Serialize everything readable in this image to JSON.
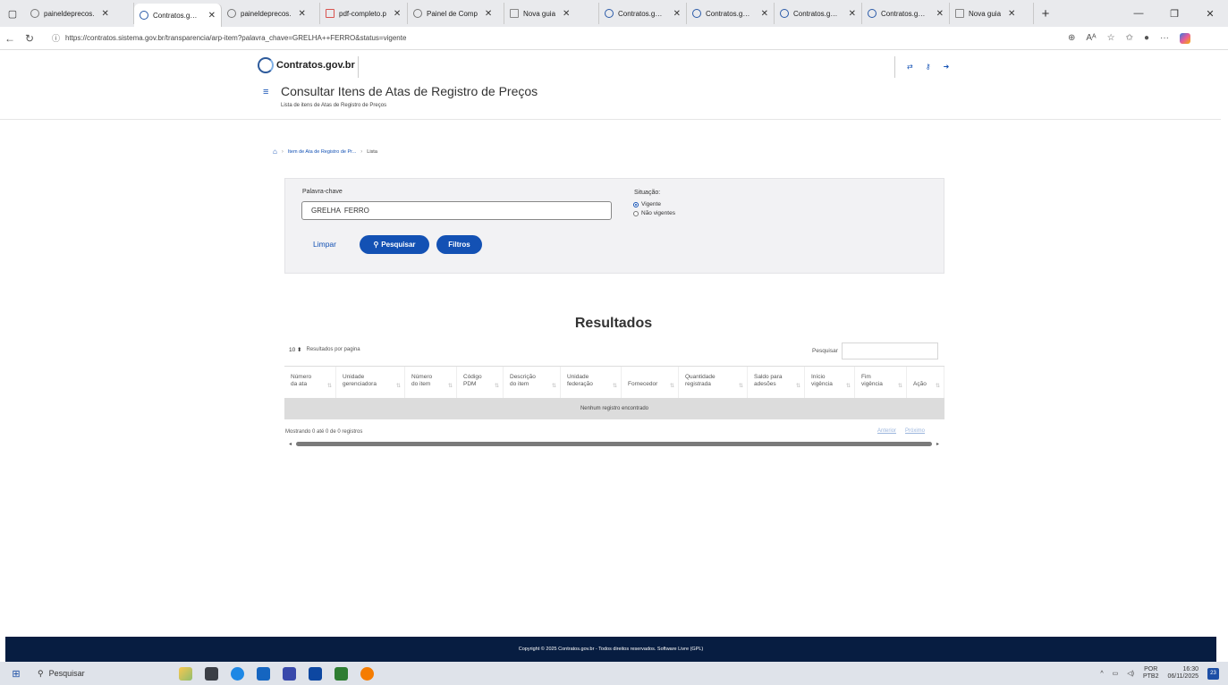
{
  "browser": {
    "tabs": [
      {
        "label": "paineldeprecos.",
        "icon": "globe-icon",
        "active": false
      },
      {
        "label": "Contratos.gov.br",
        "icon": "contratos-icon",
        "active": true
      },
      {
        "label": "paineldeprecos.",
        "icon": "globe-icon",
        "active": false
      },
      {
        "label": "pdf-completo.p",
        "icon": "pdf-icon",
        "active": false
      },
      {
        "label": "Painel de Comp",
        "icon": "globe-icon",
        "active": false
      },
      {
        "label": "Nova guia",
        "icon": "page-icon",
        "active": false
      },
      {
        "label": "Contratos.gov.br",
        "icon": "contratos-icon",
        "active": false
      },
      {
        "label": "Contratos.gov.br",
        "icon": "contratos-icon",
        "active": false
      },
      {
        "label": "Contratos.gov.br",
        "icon": "contratos-icon",
        "active": false
      },
      {
        "label": "Contratos.gov.br",
        "icon": "contratos-icon",
        "active": false
      },
      {
        "label": "Nova guia",
        "icon": "page-icon",
        "active": false
      }
    ],
    "url": "https://contratos.sistema.gov.br/transparencia/arp-item?palavra_chave=GRELHA++FERRO&status=vigente"
  },
  "site": {
    "logo_text": "Contratos.gov.br",
    "page_title": "Consultar Itens de Atas de Registro de Preços",
    "page_subtitle": "Lista de itens de Atas de Registro de Preços"
  },
  "breadcrumb": {
    "item1": "Item de Ata de Registro de Pr...",
    "item2": "Lista"
  },
  "search": {
    "keyword_label": "Palavra-chave",
    "keyword_value": "GRELHA  FERRO",
    "situation_label": "Situação:",
    "option_active": "Vigente",
    "option_inactive": "Não vigentes",
    "clear_label": "Limpar",
    "search_label": "Pesquisar",
    "filters_label": "Filtros"
  },
  "results": {
    "title": "Resultados",
    "per_page_value": "10",
    "per_page_label": "Resultados por pagina",
    "search_label": "Pesquisar",
    "columns": [
      [
        "Número",
        "da ata"
      ],
      [
        "Unidade",
        "gerenciadora"
      ],
      [
        "Número",
        "do item"
      ],
      [
        "Código",
        "PDM"
      ],
      [
        "Descrição",
        "do item"
      ],
      [
        "Unidade",
        "federação"
      ],
      [
        "",
        "Fornecedor"
      ],
      [
        "Quantidade",
        "registrada"
      ],
      [
        "Saldo para",
        "adesões"
      ],
      [
        "Início",
        "vigência"
      ],
      [
        "Fim",
        "vigência"
      ],
      [
        "",
        "Ação"
      ]
    ],
    "empty_message": "Nenhum registro encontrado",
    "showing": "Mostrando 0 até 0 de 0 registros",
    "prev": "Anterior",
    "next": "Próximo"
  },
  "footer": {
    "text": "Copyright © 2025 Contratos.gov.br - Todos direitos reservados. Software Livre (GPL)"
  },
  "taskbar": {
    "search_placeholder": "Pesquisar",
    "lang_top": "POR",
    "lang_bottom": "PTB2",
    "time": "16:30",
    "date": "06/11/2025",
    "notifications": "23"
  }
}
